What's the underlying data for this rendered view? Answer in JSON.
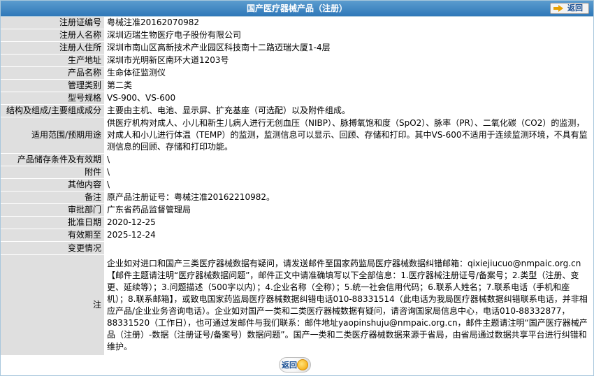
{
  "header": {
    "title": "国产医疗器械产品（注册）",
    "back_label": "返回"
  },
  "rows": [
    {
      "label": "注册证编号",
      "value": "粤械注准20162070982"
    },
    {
      "label": "注册人名称",
      "value": "深圳迈瑞生物医疗电子股份有限公司"
    },
    {
      "label": "注册人住所",
      "value": "深圳市南山区高新技术产业园区科技南十二路迈瑞大厦1-4层"
    },
    {
      "label": "生产地址",
      "value": "深圳市光明新区南环大道1203号"
    },
    {
      "label": "产品名称",
      "value": "生命体征监测仪"
    },
    {
      "label": "管理类别",
      "value": "第二类"
    },
    {
      "label": "型号规格",
      "value": "VS-900、VS-600"
    },
    {
      "label": "结构及组成/主要组成成分",
      "value": "主要由主机、电池、显示屏、扩充基座（可选配）以及附件组成。"
    },
    {
      "label": "适用范围/预期用途",
      "value": "供医疗机构对成人、小儿和新生儿病人进行无创血压（NIBP）、脉搏氧饱和度（SpO2）、脉率（PR）、二氧化碳（CO2）的监测，对成人和小儿进行体温（TEMP）的监测，监测信息可以显示、回顾、存储和打印。其中VS-600不适用于连续监测环境，不具有监测信息的回顾、存储和打印功能。"
    },
    {
      "label": "产品储存条件及有效期",
      "value": "\\"
    },
    {
      "label": "附件",
      "value": "\\"
    },
    {
      "label": "其他内容",
      "value": "\\"
    },
    {
      "label": "备注",
      "value": "原产品注册证号：粤械注准20162210982。"
    },
    {
      "label": "审批部门",
      "value": "广东省药品监督管理局"
    },
    {
      "label": "批准日期",
      "value": "2020-12-25"
    },
    {
      "label": "有效期至",
      "value": "2025-12-24"
    },
    {
      "label": "变更情况",
      "value": ""
    }
  ],
  "note": {
    "label": "注",
    "text": "企业如对进口和国产三类医疗器械数据有疑问，请发送邮件至国家药监局医疗器械数据纠错邮箱：qixiejiucuo@nmpaic.org.cn【邮件主题请注明“医疗器械数据问题”，邮件正文中请准确填写以下全部信息：1.医疗器械注册证号/备案号；2.类型（注册、变更、延续等）；3.问题描述（500字以内）；4.企业名称（全称）；5.统一社会信用代码；6.联系人姓名；7.联系电话（手机和座机）；8.联系邮箱】，或致电国家药监局医疗器械数据纠错电话010-88331514（此电话为我局医疗器械数据纠错联系电话，并非相应产品/企业业务咨询电话）。企业如对国产一类和二类医疗器械数据有疑问，请咨询国家局信息中心，电话010-88332877，88331520（工作日），也可通过发邮件与我们联系：邮件地址yaopinshuju@nmpaic.org.cn，邮件主题请注明“国产医疗器械产品（注册）-数据（注册证号/备案号）数据问题”。国产一类和二类医疗器械数据来源于省局，由省局通过数据共享平台进行纠错和维护。"
  },
  "footer": {
    "back_label": "返回"
  }
}
